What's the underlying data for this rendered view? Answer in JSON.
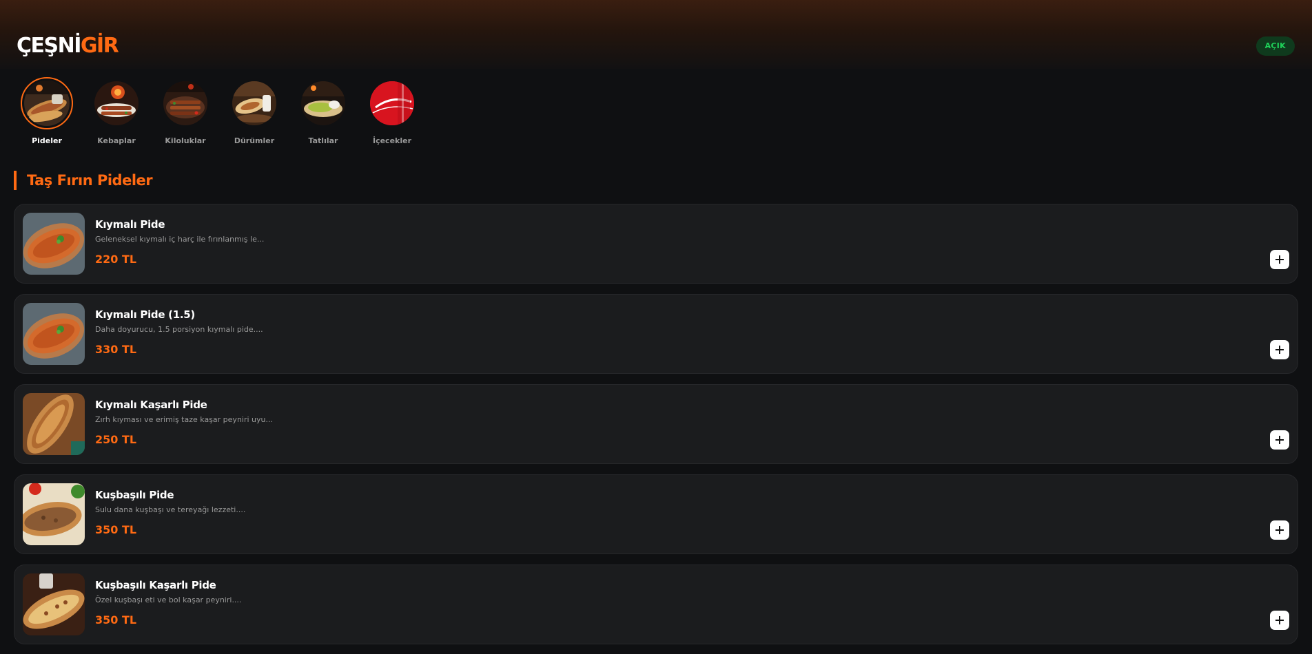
{
  "header": {
    "logo_part1": "ÇEŞNİ",
    "logo_part2": "GİR",
    "status": "AÇIK",
    "colors": {
      "accent": "#ff6a13",
      "status_bg": "#0f3a1d",
      "status_text": "#1fd15a"
    }
  },
  "categories": [
    {
      "label": "Pideler",
      "icon": "pide-image",
      "active": true
    },
    {
      "label": "Kebaplar",
      "icon": "kebab-image"
    },
    {
      "label": "Kiloluklar",
      "icon": "grill-platter-image"
    },
    {
      "label": "Dürümler",
      "icon": "wrap-image"
    },
    {
      "label": "Tatlılar",
      "icon": "dessert-image"
    },
    {
      "label": "İçecekler",
      "icon": "cola-image"
    }
  ],
  "section": {
    "title": "Taş Fırın Pideler"
  },
  "items": [
    {
      "name": "Kıymalı Pide",
      "description": "Geleneksel kıymalı iç harç ile fırınlanmış le...",
      "price": "220 TL",
      "image": "kiymali-pide-photo"
    },
    {
      "name": "Kıymalı Pide (1.5)",
      "description": "Daha doyurucu, 1.5 porsiyon kıymalı pide....",
      "price": "330 TL",
      "image": "kiymali-pide-photo"
    },
    {
      "name": "Kıymalı Kaşarlı Pide",
      "description": "Zırh kıyması ve erimiş taze kaşar peyniri uyu...",
      "price": "250 TL",
      "image": "kasarli-pide-photo"
    },
    {
      "name": "Kuşbaşılı Pide",
      "description": "Sulu dana kuşbaşı ve tereyağı lezzeti....",
      "price": "350 TL",
      "image": "kusbasili-pide-photo"
    },
    {
      "name": "Kuşbaşılı Kaşarlı Pide",
      "description": "Özel kuşbaşı eti ve bol kaşar peyniri....",
      "price": "350 TL",
      "image": "kusbasili-kasarli-pide-photo"
    }
  ]
}
